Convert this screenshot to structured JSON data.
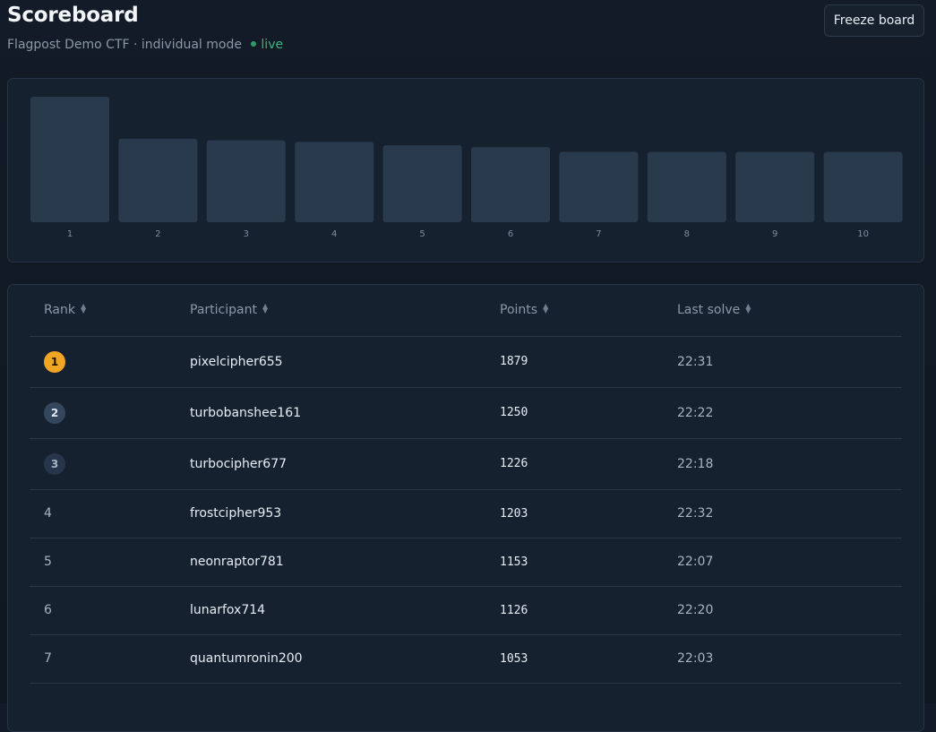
{
  "header": {
    "title": "Scoreboard",
    "subtitle": "Flagpost Demo CTF · individual mode",
    "live_label": "live",
    "freeze_label": "Freeze board"
  },
  "colors": {
    "accent_live": "#3fb27f",
    "gold": "#f0a623",
    "bar": "#293a4d"
  },
  "chart_data": {
    "type": "bar",
    "categories": [
      "1",
      "2",
      "3",
      "4",
      "5",
      "6",
      "7",
      "8",
      "9",
      "10"
    ],
    "values": [
      1879,
      1250,
      1226,
      1203,
      1153,
      1126,
      1053,
      1052,
      1052,
      1052
    ],
    "title": "",
    "xlabel": "",
    "ylabel": "",
    "grid": false
  },
  "table": {
    "columns": [
      "Rank",
      "Participant",
      "Points",
      "Last solve"
    ],
    "rows": [
      {
        "rank": "1",
        "participant": "pixelcipher655",
        "points": "1879",
        "last": "22:31"
      },
      {
        "rank": "2",
        "participant": "turbobanshee161",
        "points": "1250",
        "last": "22:22"
      },
      {
        "rank": "3",
        "participant": "turbocipher677",
        "points": "1226",
        "last": "22:18"
      },
      {
        "rank": "4",
        "participant": "frostcipher953",
        "points": "1203",
        "last": "22:32"
      },
      {
        "rank": "5",
        "participant": "neonraptor781",
        "points": "1153",
        "last": "22:07"
      },
      {
        "rank": "6",
        "participant": "lunarfox714",
        "points": "1126",
        "last": "22:20"
      },
      {
        "rank": "7",
        "participant": "quantumronin200",
        "points": "1053",
        "last": "22:03"
      }
    ]
  }
}
